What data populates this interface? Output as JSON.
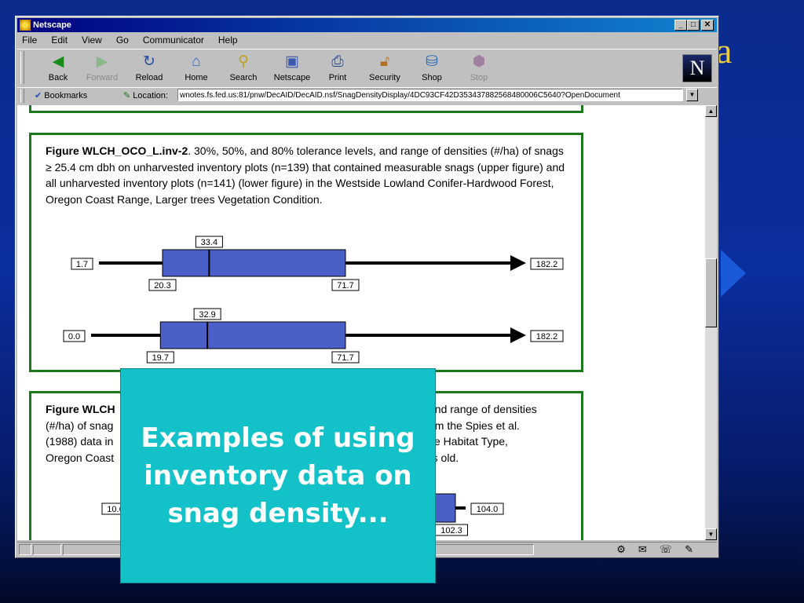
{
  "slide": {
    "title_fragment": "a",
    "callout_text": "Examples of using inventory data on snag density..."
  },
  "window": {
    "title": "Netscape",
    "menu": [
      "File",
      "Edit",
      "View",
      "Go",
      "Communicator",
      "Help"
    ],
    "toolbar": [
      {
        "label": "Back",
        "icon": "back-arrow-icon",
        "enabled": true
      },
      {
        "label": "Forward",
        "icon": "forward-arrow-icon",
        "enabled": false
      },
      {
        "label": "Reload",
        "icon": "reload-icon",
        "enabled": true
      },
      {
        "label": "Home",
        "icon": "home-icon",
        "enabled": true
      },
      {
        "label": "Search",
        "icon": "search-icon",
        "enabled": true
      },
      {
        "label": "Netscape",
        "icon": "netscape-icon",
        "enabled": true
      },
      {
        "label": "Print",
        "icon": "print-icon",
        "enabled": true
      },
      {
        "label": "Security",
        "icon": "lock-icon",
        "enabled": true
      },
      {
        "label": "Shop",
        "icon": "shop-icon",
        "enabled": true
      },
      {
        "label": "Stop",
        "icon": "stop-icon",
        "enabled": false
      }
    ],
    "bookmarks_label": "Bookmarks",
    "location_label": "Location:",
    "url": "wnotes.fs.fed.us:81/pnw/DecAID/DecAID.nsf/SnagDensityDisplay/4DC93CF42D353437882568480006C5640?OpenDocument"
  },
  "figures": [
    {
      "caption_bold": "Figure WLCH_OCO_L.inv-2",
      "caption_rest": ". 30%, 50%, and 80% tolerance levels, and range of densities (#/ha) of snags ≥ 25.4 cm dbh on unharvested inventory plots (n=139) that contained measurable snags (upper figure) and all unharvested inventory plots (n=141) (lower figure) in the Westside Lowland Conifer-Hardwood Forest, Oregon Coast Range, Larger trees Vegetation Condition."
    },
    {
      "caption_bold": "Figure WLCH",
      "caption_rest_lines": [
        "and range of densities",
        "(#/ha) of snag",
        "om the Spies et al.",
        "(1988) data in",
        "ife Habitat Type,",
        "Oregon Coast",
        "rs old."
      ]
    }
  ],
  "chart_data": [
    {
      "type": "box",
      "series": [
        {
          "min": 1.7,
          "q30": 20.3,
          "median": 33.4,
          "q80": 71.7,
          "max": 182.2
        },
        {
          "min": 0.0,
          "q30": 19.7,
          "median": 32.9,
          "q80": 71.7,
          "max": 182.2
        }
      ],
      "labels": {
        "s0": {
          "min": "1.7",
          "q30": "20.3",
          "median": "33.4",
          "q80": "71.7",
          "max": "182.2"
        },
        "s1": {
          "min": "0.0",
          "q30": "19.7",
          "median": "32.9",
          "q80": "71.7",
          "max": "182.2"
        }
      }
    },
    {
      "type": "box",
      "series": [
        {
          "min": 10.6,
          "q80": 102.3,
          "max": 104.0
        }
      ],
      "labels": {
        "min": "10.6",
        "q80": "102.3",
        "max": "104.0"
      }
    }
  ],
  "colors": {
    "box_fill": "#4a5fc8",
    "panel_border": "#1a7a1a",
    "callout_bg": "#12c2c8"
  }
}
